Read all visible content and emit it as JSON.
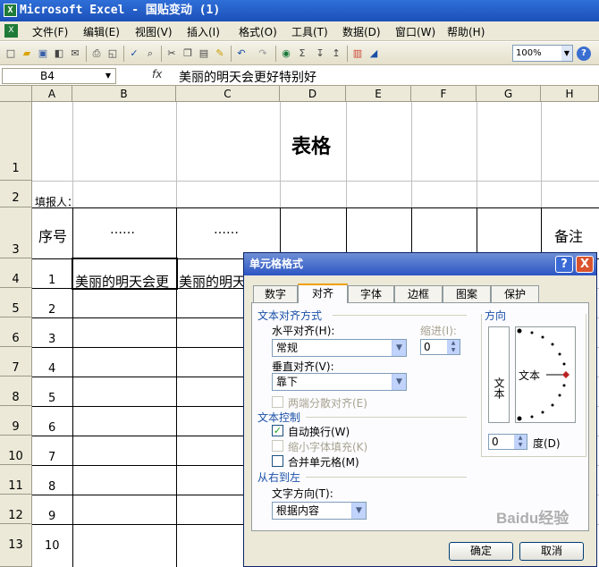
{
  "window": {
    "title": "Microsoft Excel - 国贴变动 (1)",
    "app_icon": "excel-icon"
  },
  "menu": [
    "文件(F)",
    "编辑(E)",
    "视图(V)",
    "插入(I)",
    "格式(O)",
    "工具(T)",
    "数据(D)",
    "窗口(W)",
    "帮助(H)"
  ],
  "toolbar": {
    "zoom": "100%"
  },
  "formula_bar": {
    "cell_ref": "B4",
    "fx": "fx",
    "value": "美丽的明天会更好特别好"
  },
  "columns": [
    "A",
    "B",
    "C",
    "D",
    "E",
    "F",
    "G",
    "H"
  ],
  "rows": [
    "1",
    "2",
    "3",
    "4",
    "5",
    "6",
    "7",
    "8",
    "9",
    "10",
    "11",
    "12",
    "13"
  ],
  "sheet": {
    "title": "表格",
    "filler_label": "填报人：",
    "header": {
      "seq": "序号",
      "dots": "……",
      "note": "备注"
    },
    "seq_values": [
      "1",
      "2",
      "3",
      "4",
      "5",
      "6",
      "7",
      "8",
      "9",
      "10"
    ],
    "b4": "美丽的明天会更",
    "c4": "美丽的明天"
  },
  "dialog": {
    "title": "单元格格式",
    "help": "?",
    "close": "X",
    "tabs": [
      "数字",
      "对齐",
      "字体",
      "边框",
      "图案",
      "保护"
    ],
    "active_tab": "对齐",
    "section_text_align": "文本对齐方式",
    "horizontal_label": "水平对齐(H):",
    "horizontal_value": "常规",
    "indent_label": "缩进(I):",
    "indent_value": "0",
    "vertical_label": "垂直对齐(V):",
    "vertical_value": "靠下",
    "justify_distributed": "两端分散对齐(E)",
    "section_text_control": "文本控制",
    "wrap_text": "自动换行(W)",
    "wrap_text_checked": true,
    "shrink_to_fit": "缩小字体填充(K)",
    "merge_cells": "合并单元格(M)",
    "section_rtl": "从右到左",
    "text_direction_label": "文字方向(T):",
    "text_direction_value": "根据内容",
    "section_orientation": "方向",
    "vertical_text": "文本",
    "orient_text": "文本",
    "degree_value": "0",
    "degree_label": "度(D)",
    "ok": "确定",
    "cancel": "取消"
  },
  "watermark": "Baidu经验"
}
